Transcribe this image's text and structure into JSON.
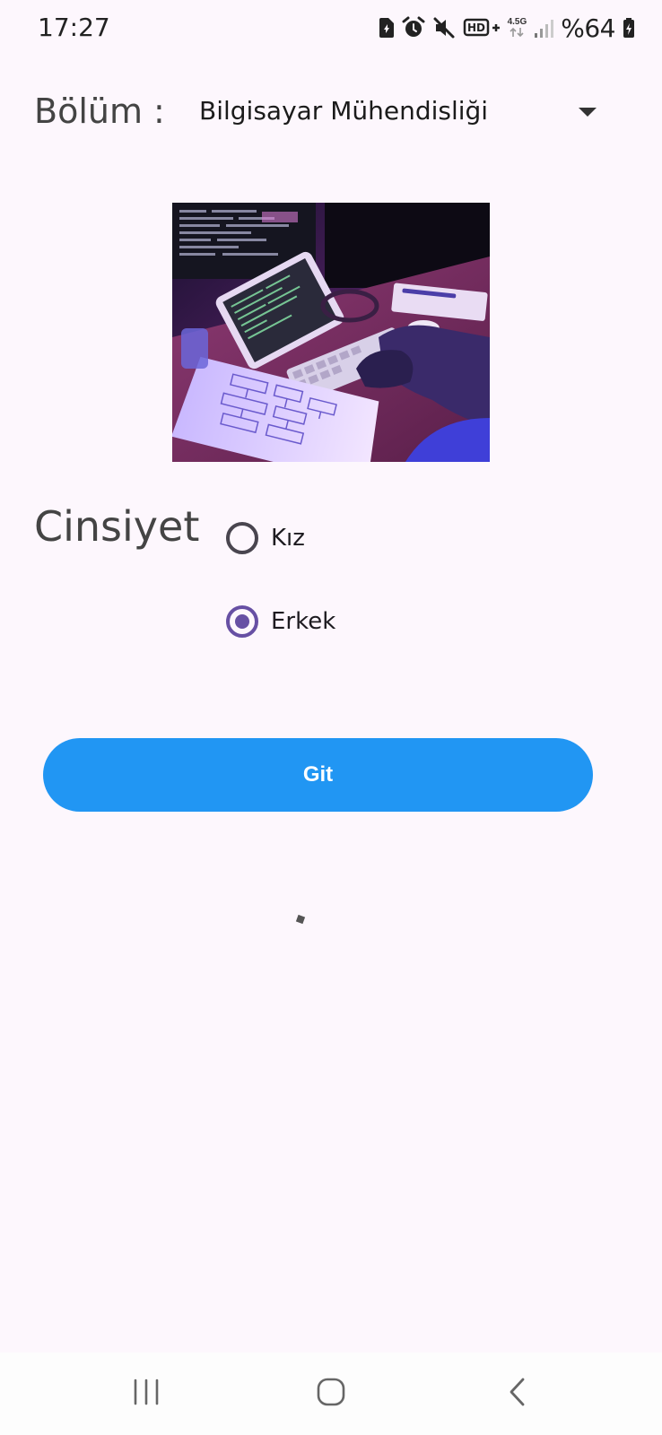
{
  "status_bar": {
    "time": "17:27",
    "battery": "%64",
    "network_label": "4.5G",
    "icons": [
      "sim-icon",
      "alarm-icon",
      "mute-icon",
      "volte-icon",
      "data-icon",
      "signal-icon",
      "battery-icon"
    ]
  },
  "form": {
    "department_label": "Bölüm :",
    "department_value": "Bilgisayar Mühendisliği",
    "gender_label": "Cinsiyet",
    "gender_options": [
      {
        "label": "Kız",
        "checked": false
      },
      {
        "label": "Erkek",
        "checked": true
      }
    ],
    "submit_label": "Git"
  },
  "colors": {
    "background": "#fdf7fd",
    "button": "#2196f3",
    "radio_checked": "#6750a4",
    "radio_unchecked": "#49454f"
  },
  "navigation": {
    "icons": [
      "recents-icon",
      "home-icon",
      "back-icon"
    ]
  }
}
